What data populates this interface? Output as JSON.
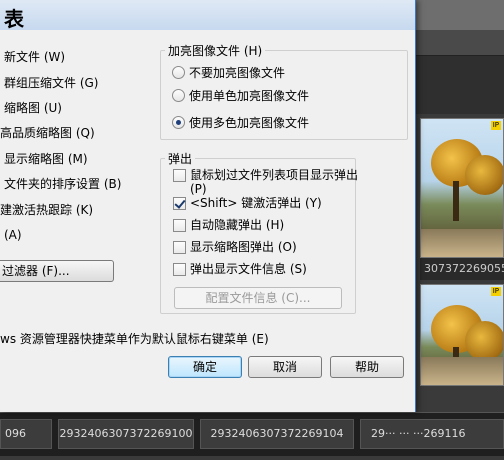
{
  "dialog": {
    "title": "表",
    "left_options": [
      "新文件 (W)",
      "群组压缩文件 (G)",
      "缩略图 (U)",
      "高品质缩略图 (Q)",
      "显示缩略图 (M)",
      "文件夹的排序设置 (B)",
      "建激活热跟踪 (K)",
      "(A)"
    ],
    "filter_button": "过滤器 (F)...",
    "explorer_option": "ws 资源管理器快捷菜单作为默认鼠标右键菜单 (E)",
    "highlight_group": {
      "label": "加亮图像文件 (H)",
      "options": [
        {
          "label": "不要加亮图像文件",
          "selected": false
        },
        {
          "label": "使用单色加亮图像文件",
          "selected": false
        },
        {
          "label": "使用多色加亮图像文件",
          "selected": true
        }
      ]
    },
    "popup_group": {
      "label": "弹出",
      "options": [
        {
          "label": "鼠标划过文件列表项目显示弹出 (P)",
          "checked": false
        },
        {
          "label": "<Shift> 键激活弹出 (Y)",
          "checked": true
        },
        {
          "label": "自动隐藏弹出 (H)",
          "checked": false
        },
        {
          "label": "显示缩略图弹出 (O)",
          "checked": false
        },
        {
          "label": "弹出显示文件信息 (S)",
          "checked": false
        }
      ],
      "config_button": "配置文件信息 (C)..."
    },
    "buttons": {
      "ok": "确定",
      "cancel": "取消",
      "help": "帮助"
    }
  },
  "background": {
    "thumb_badge": "IP",
    "thumb_caption": "307372269055",
    "bottom_cells": [
      "096",
      "2932406307372269100",
      "2932406307372269104",
      "29··· ··· ···269116"
    ]
  }
}
